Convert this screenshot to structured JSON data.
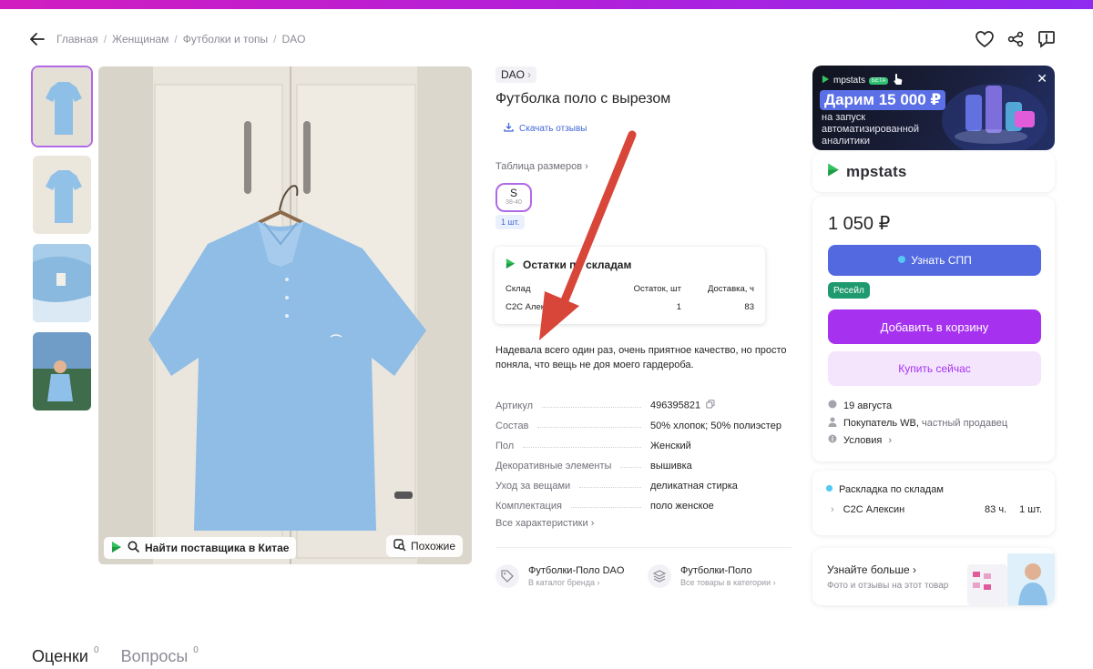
{
  "breadcrumbs": [
    "Главная",
    "Женщинам",
    "Футболки и топы",
    "DAO"
  ],
  "product": {
    "brand": "DAO",
    "title": "Футболка поло с вырезом",
    "download_reviews": "Скачать отзывы",
    "size_table_link": "Таблица размеров",
    "size": {
      "label": "S",
      "range": "38-40"
    },
    "qty": "1 шт.",
    "description": "Надевала всего один раз, очень приятное качество, но просто поняла, что вещь не доя моего гардероба.",
    "all_specs": "Все характеристики",
    "specs": [
      {
        "label": "Артикул",
        "value": "496395821"
      },
      {
        "label": "Состав",
        "value": "50% хлопок; 50% полиэстер"
      },
      {
        "label": "Пол",
        "value": "Женский"
      },
      {
        "label": "Декоративные элементы",
        "value": "вышивка"
      },
      {
        "label": "Уход за вещами",
        "value": "деликатная стирка"
      },
      {
        "label": "Комплектация",
        "value": "поло женское"
      }
    ]
  },
  "photo": {
    "find_supplier": "Найти поставщика в Китае",
    "similar": "Похожие"
  },
  "stock_widget": {
    "title": "Остатки по складам",
    "title_visible": "Остатки по",
    "title_visible_tail": "складам",
    "headers": [
      "Склад",
      "Остаток, шт",
      "Доставка, ч"
    ],
    "row": {
      "warehouse": "С2С Алексин",
      "warehouse_visible": "С2С Алексин",
      "stock": "1",
      "delivery": "83"
    }
  },
  "links": [
    {
      "title": "Футболки-Поло DAO",
      "sub": "В каталог бренда"
    },
    {
      "title": "Футболки-Поло",
      "sub": "Все товары в категории"
    }
  ],
  "ad": {
    "brand": "mpstats",
    "beta": "БЕТА",
    "title": "Дарим 15 000 ₽",
    "subtitle": "на запуск автоматизированной аналитики"
  },
  "mpstats_card": {
    "name": "mpstats"
  },
  "buy": {
    "price": "1 050 ₽",
    "spp_button": "Узнать СПП",
    "resale_badge": "Ресейл",
    "cart_button": "Добавить в корзину",
    "buy_now": "Купить сейчас",
    "delivery_date": "19 августа",
    "seller_main": "Покупатель WB,",
    "seller_type": "частный продавец",
    "conditions": "Условия"
  },
  "warehouses": {
    "title": "Раскладка по складам",
    "row": {
      "name": "С2С Алексин",
      "hours": "83 ч.",
      "qty": "1 шт."
    }
  },
  "learn_more": {
    "title": "Узнайте больше",
    "subtitle": "Фото и отзывы на этот товар"
  },
  "bottom_tabs": [
    {
      "label": "Оценки",
      "count": "0"
    },
    {
      "label": "Вопросы",
      "count": "0"
    }
  ],
  "colors": {
    "accent_purple": "#a632ef",
    "spp_blue": "#5269e0",
    "resale_green": "#1e9a6e",
    "arrow_red": "#d8463a"
  }
}
